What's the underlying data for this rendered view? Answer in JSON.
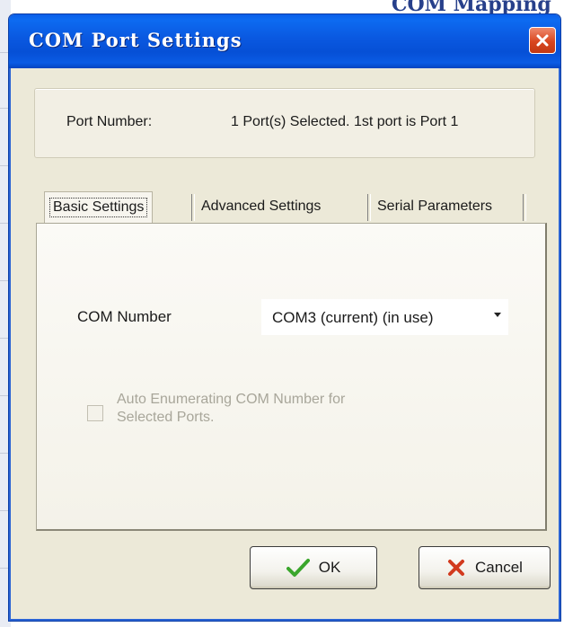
{
  "background": {
    "partial_text": "COM Mapping"
  },
  "window": {
    "title": "COM Port Settings",
    "close_icon": "close-icon",
    "colors": {
      "titlebar": "#0a58e0",
      "close": "#d9461f",
      "face": "#ece9d8"
    }
  },
  "port_info": {
    "label": "Port Number:",
    "value": "1 Port(s) Selected. 1st port is Port 1"
  },
  "tabs": [
    {
      "label": "Basic Settings",
      "active": true
    },
    {
      "label": "Advanced Settings",
      "active": false
    },
    {
      "label": "Serial Parameters",
      "active": false
    }
  ],
  "basic": {
    "com_label": "COM Number",
    "com_value": "COM3 (current) (in use)",
    "auto_enum": {
      "line1": "Auto Enumerating COM Number for",
      "line2": "Selected Ports.",
      "checked": false,
      "enabled": false
    }
  },
  "buttons": {
    "ok_label": "OK",
    "ok_icon": "check-icon",
    "cancel_label": "Cancel",
    "cancel_icon": "cancel-x-icon"
  }
}
